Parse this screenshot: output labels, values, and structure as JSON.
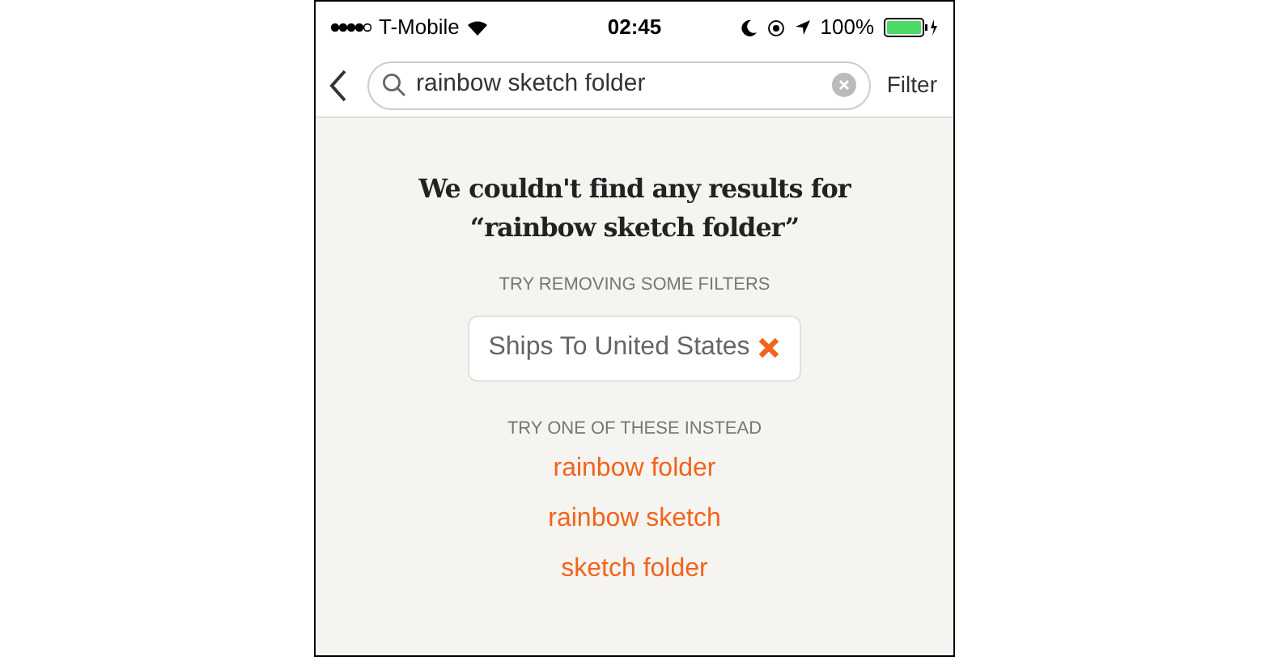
{
  "status_bar": {
    "carrier": "T-Mobile",
    "time": "02:45",
    "battery": "100%"
  },
  "search": {
    "value": "rainbow sketch folder",
    "filter_label": "Filter"
  },
  "empty_state": {
    "title": "We couldn't find any results for",
    "query": "“rainbow sketch folder”"
  },
  "filters": {
    "heading": "TRY REMOVING SOME FILTERS",
    "items": [
      {
        "label": "Ships To United States"
      }
    ]
  },
  "suggestions": {
    "heading": "TRY ONE OF THESE INSTEAD",
    "items": [
      "rainbow folder",
      "rainbow sketch",
      "sketch folder"
    ]
  }
}
